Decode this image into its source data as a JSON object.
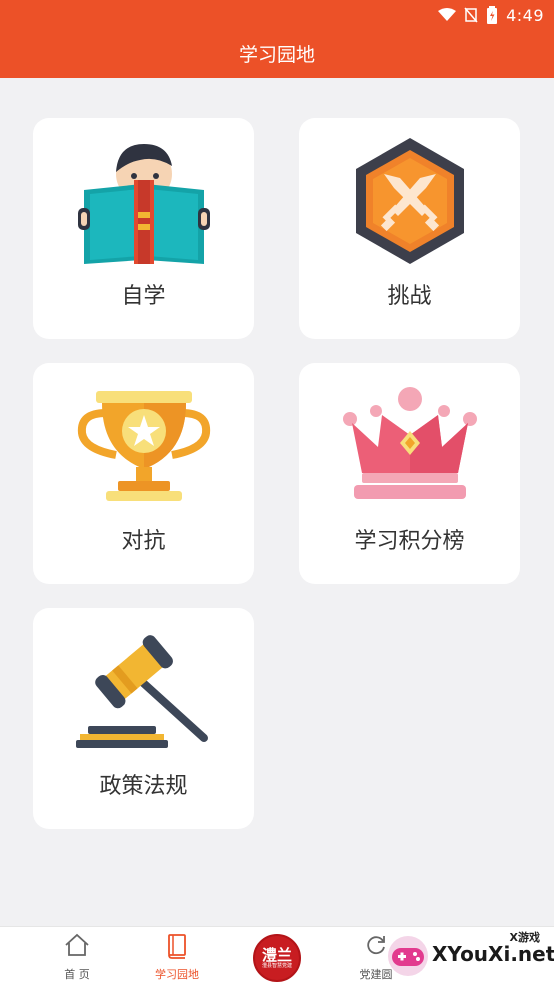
{
  "status_bar": {
    "time": "4:49"
  },
  "header": {
    "title": "学习园地"
  },
  "cards": [
    {
      "label": "自学",
      "icon": "reading-book-icon"
    },
    {
      "label": "挑战",
      "icon": "crossed-swords-icon"
    },
    {
      "label": "对抗",
      "icon": "trophy-icon"
    },
    {
      "label": "学习积分榜",
      "icon": "crown-icon"
    },
    {
      "label": "政策法规",
      "icon": "gavel-icon"
    }
  ],
  "bottom_nav": {
    "items": [
      {
        "label": "首 页",
        "icon": "home-icon"
      },
      {
        "label": "学习园地",
        "icon": "book-icon",
        "active": true
      },
      {
        "label": "党建圆",
        "icon": "refresh-icon"
      }
    ],
    "center": {
      "big": "澧兰",
      "small": "澧县智慧党建"
    }
  },
  "watermark": {
    "text": "XYouXi.net",
    "top": "X游戏"
  },
  "colors": {
    "accent": "#ec5128",
    "background": "#f1f1f3",
    "card": "#ffffff"
  }
}
